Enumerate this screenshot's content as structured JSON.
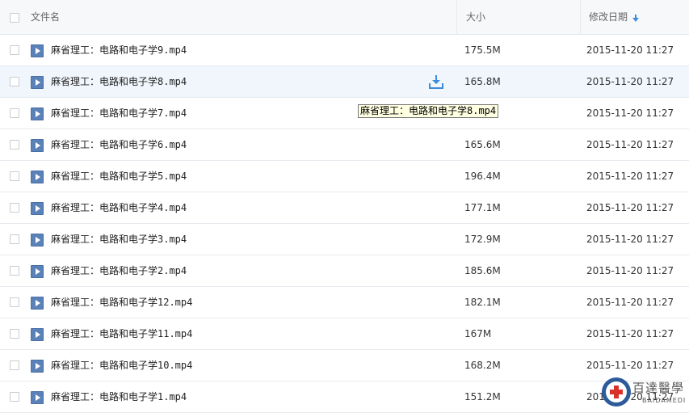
{
  "header": {
    "name_label": "文件名",
    "size_label": "大小",
    "date_label": "修改日期"
  },
  "files": [
    {
      "name": "麻省理工：电路和电子学9.mp4",
      "size": "175.5M",
      "date": "2015-11-20 11:27"
    },
    {
      "name": "麻省理工：电路和电子学8.mp4",
      "size": "165.8M",
      "date": "2015-11-20 11:27"
    },
    {
      "name": "麻省理工：电路和电子学7.mp4",
      "size": "",
      "date": "2015-11-20 11:27"
    },
    {
      "name": "麻省理工：电路和电子学6.mp4",
      "size": "165.6M",
      "date": "2015-11-20 11:27"
    },
    {
      "name": "麻省理工：电路和电子学5.mp4",
      "size": "196.4M",
      "date": "2015-11-20 11:27"
    },
    {
      "name": "麻省理工：电路和电子学4.mp4",
      "size": "177.1M",
      "date": "2015-11-20 11:27"
    },
    {
      "name": "麻省理工：电路和电子学3.mp4",
      "size": "172.9M",
      "date": "2015-11-20 11:27"
    },
    {
      "name": "麻省理工：电路和电子学2.mp4",
      "size": "185.6M",
      "date": "2015-11-20 11:27"
    },
    {
      "name": "麻省理工：电路和电子学12.mp4",
      "size": "182.1M",
      "date": "2015-11-20 11:27"
    },
    {
      "name": "麻省理工：电路和电子学11.mp4",
      "size": "167M",
      "date": "2015-11-20 11:27"
    },
    {
      "name": "麻省理工：电路和电子学10.mp4",
      "size": "168.2M",
      "date": "2015-11-20 11:27"
    },
    {
      "name": "麻省理工：电路和电子学1.mp4",
      "size": "151.2M",
      "date": "2015-11-20 11:27"
    }
  ],
  "tooltip": {
    "text": "麻省理工：电路和电子学8.mp4"
  },
  "watermark": {
    "text": "百達醫學",
    "subtext": "BAIDAMEDI"
  },
  "icons": {
    "file": "video-file-icon",
    "download": "download-icon",
    "sort": "sort-down-arrow-icon"
  },
  "colors": {
    "header_bg": "#f7f8fa",
    "hover_row_bg": "#f0f6fc",
    "accent": "#3b8cd9",
    "tooltip_bg": "#ffffe1"
  }
}
